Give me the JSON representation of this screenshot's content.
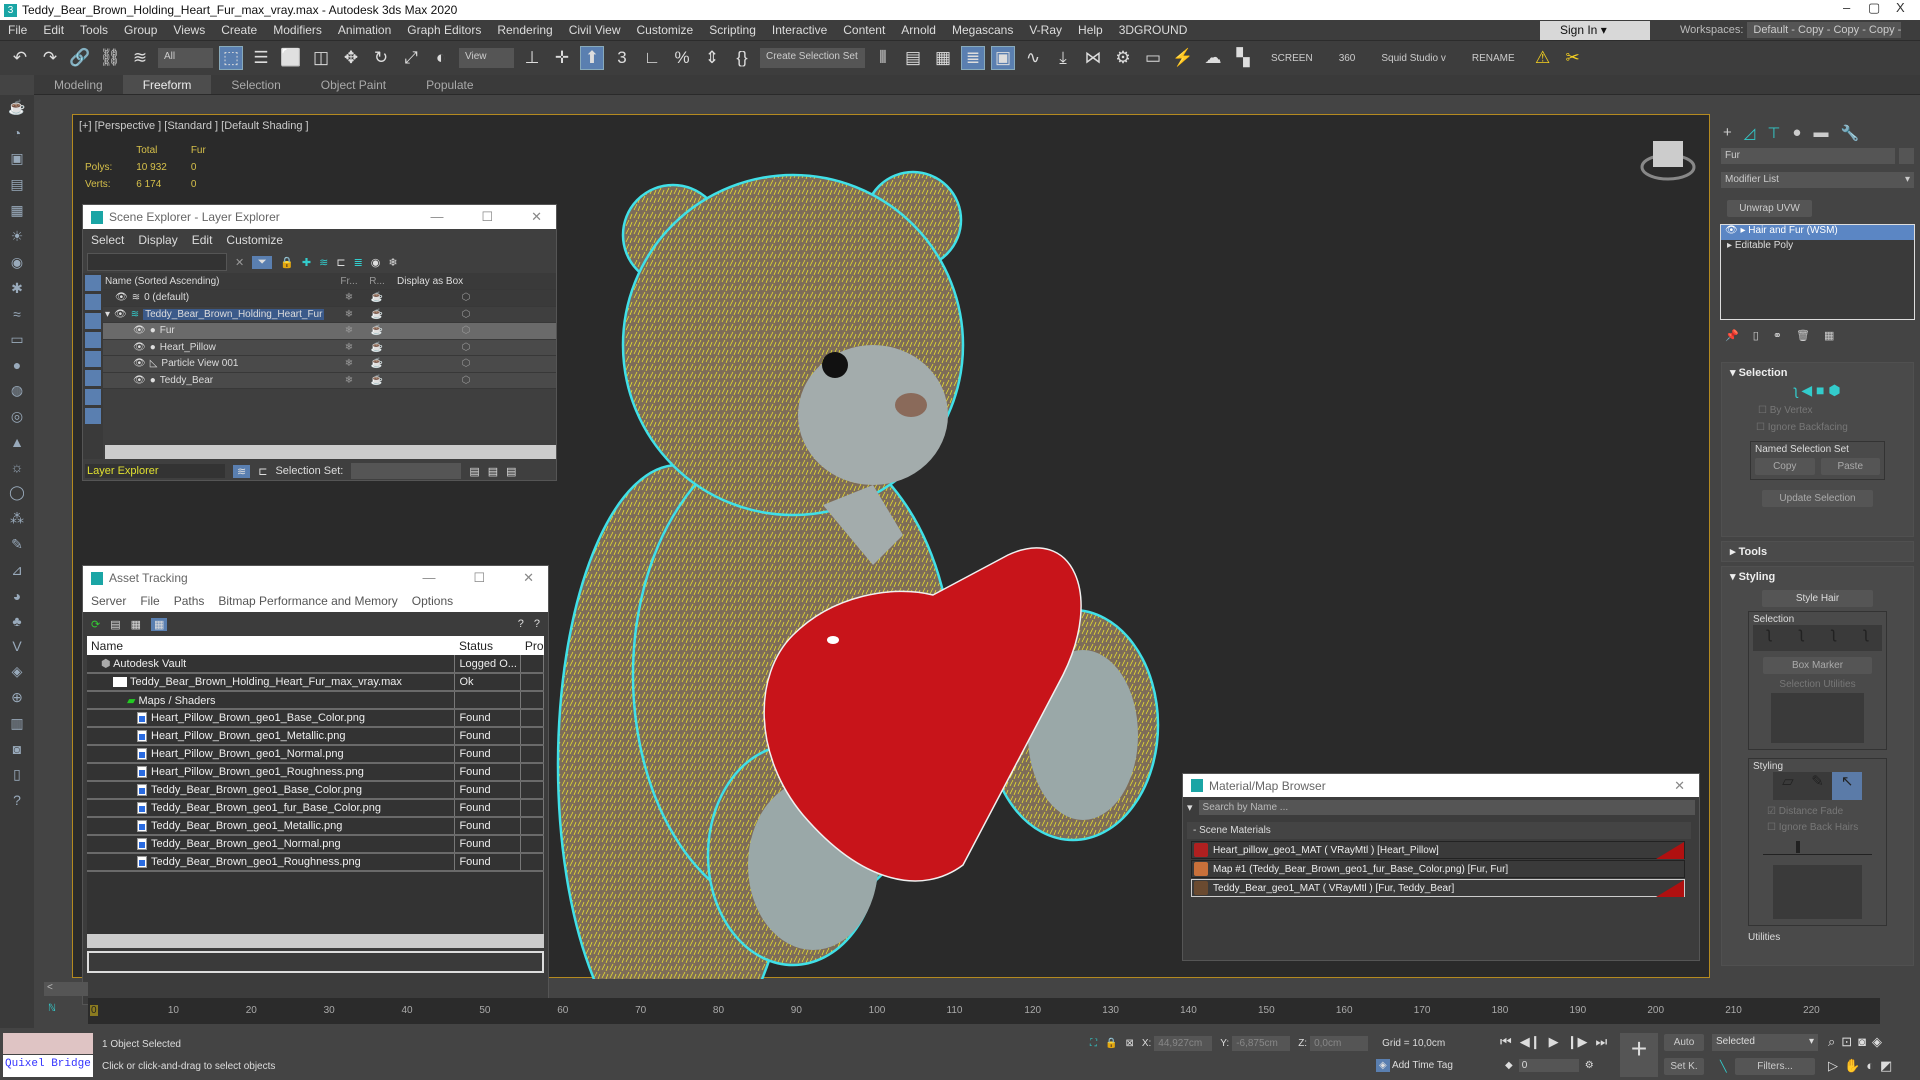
{
  "titlebar": {
    "title": "Teddy_Bear_Brown_Holding_Heart_Fur_max_vray.max - Autodesk 3ds Max 2020",
    "minimize": "–",
    "maximize": "▢",
    "close": "X"
  },
  "menu": [
    "File",
    "Edit",
    "Tools",
    "Group",
    "Views",
    "Create",
    "Modifiers",
    "Animation",
    "Graph Editors",
    "Rendering",
    "Civil View",
    "Customize",
    "Scripting",
    "Interactive",
    "Content",
    "Arnold",
    "Megascans",
    "V-Ray",
    "Help",
    "3DGROUND"
  ],
  "account": {
    "sign_in": "Sign In",
    "workspaces_label": "Workspaces:",
    "workspace": "Default - Copy - Copy - Copy - Copy"
  },
  "toolbar": {
    "filter": "All",
    "ref_coord": "View",
    "selection_set": "Create Selection Set",
    "screen": "SCREEN",
    "n360": "360",
    "studio": "Squid Studio v",
    "rename": "RENAME"
  },
  "ribbon": {
    "tabs": [
      "Modeling",
      "Freeform",
      "Selection",
      "Object Paint",
      "Populate"
    ],
    "active": "Freeform"
  },
  "viewport": {
    "label": "[+] [Perspective ] [Standard ] [Default Shading ]",
    "stats": {
      "col_total": "Total",
      "col_fur": "Fur",
      "polys_label": "Polys:",
      "polys_total": "10 932",
      "polys_fur": "0",
      "verts_label": "Verts:",
      "verts_total": "6 174",
      "verts_fur": "0"
    }
  },
  "scene_explorer": {
    "title": "Scene Explorer - Layer Explorer",
    "menu": [
      "Select",
      "Display",
      "Edit",
      "Customize"
    ],
    "columns": {
      "name": "Name (Sorted Ascending)",
      "freeze": "Fr...",
      "render": "R...",
      "box": "Display as Box"
    },
    "rows": [
      {
        "name": "0 (default)",
        "level": 0
      },
      {
        "name": "Teddy_Bear_Brown_Holding_Heart_Fur",
        "level": 0
      },
      {
        "name": "Fur",
        "level": 1
      },
      {
        "name": "Heart_Pillow",
        "level": 1
      },
      {
        "name": "Particle View 001",
        "level": 1
      },
      {
        "name": "Teddy_Bear",
        "level": 1
      }
    ],
    "footer": {
      "mode": "Layer Explorer",
      "selection_set_label": "Selection Set:"
    }
  },
  "asset_tracking": {
    "title": "Asset Tracking",
    "menu": [
      "Server",
      "File",
      "Paths",
      "Bitmap Performance and Memory",
      "Options"
    ],
    "columns": [
      "Name",
      "Status",
      "Pro"
    ],
    "rows": [
      {
        "name": "Autodesk Vault",
        "status": "Logged O..."
      },
      {
        "name": "Teddy_Bear_Brown_Holding_Heart_Fur_max_vray.max",
        "status": "Ok"
      },
      {
        "name": "Maps / Shaders",
        "status": ""
      },
      {
        "name": "Heart_Pillow_Brown_geo1_Base_Color.png",
        "status": "Found"
      },
      {
        "name": "Heart_Pillow_Brown_geo1_Metallic.png",
        "status": "Found"
      },
      {
        "name": "Heart_Pillow_Brown_geo1_Normal.png",
        "status": "Found"
      },
      {
        "name": "Heart_Pillow_Brown_geo1_Roughness.png",
        "status": "Found"
      },
      {
        "name": "Teddy_Bear_Brown_geo1_Base_Color.png",
        "status": "Found"
      },
      {
        "name": "Teddy_Bear_Brown_geo1_fur_Base_Color.png",
        "status": "Found"
      },
      {
        "name": "Teddy_Bear_Brown_geo1_Metallic.png",
        "status": "Found"
      },
      {
        "name": "Teddy_Bear_Brown_geo1_Normal.png",
        "status": "Found"
      },
      {
        "name": "Teddy_Bear_Brown_geo1_Roughness.png",
        "status": "Found"
      }
    ]
  },
  "material_browser": {
    "title": "Material/Map Browser",
    "search_placeholder": "Search by Name ...",
    "group": "- Scene Materials",
    "items": [
      {
        "label": "Heart_pillow_geo1_MAT  ( VRayMtl )  [Heart_Pillow]",
        "swatch": "#b02020"
      },
      {
        "label": "Map #1 (Teddy_Bear_Brown_geo1_fur_Base_Color.png)  [Fur, Fur]",
        "swatch": "#c8703a"
      },
      {
        "label": "Teddy_Bear_geo1_MAT  ( VRayMtl )  [Fur, Teddy_Bear]",
        "swatch": "#6a4a30"
      }
    ]
  },
  "command_panel": {
    "object_name": "Fur",
    "modifier_list": "Modifier List",
    "unwrap": "Unwrap UVW",
    "stack": [
      "Hair and Fur (WSM)",
      "Editable Poly"
    ],
    "selection": {
      "title": "Selection",
      "by_vertex": "By Vertex",
      "ignore_backfacing": "Ignore Backfacing",
      "named_set": "Named Selection Set",
      "copy": "Copy",
      "paste": "Paste",
      "update": "Update Selection"
    },
    "tools": "Tools",
    "styling": {
      "title": "Styling",
      "style_hair": "Style Hair",
      "selection": "Selection",
      "box_marker": "Box Marker",
      "sel_utils": "Selection Utilities",
      "styling": "Styling",
      "distance_fade": "Distance Fade",
      "ignore_back": "Ignore Back Hairs",
      "utilities": "Utilities",
      "slider_value": 0.3
    }
  },
  "timeline": {
    "ticks": [
      "0",
      "10",
      "20",
      "30",
      "40",
      "50",
      "60",
      "70",
      "80",
      "90",
      "100",
      "110",
      "120",
      "130",
      "140",
      "150",
      "160",
      "170",
      "180",
      "190",
      "200",
      "210",
      "220"
    ]
  },
  "status": {
    "selected": "1 Object Selected",
    "hint": "Click or click-and-drag to select objects",
    "quixel": "Quixel Bridge",
    "x_label": "X:",
    "x": "44,927cm",
    "y_label": "Y:",
    "y": "-6,875cm",
    "z_label": "Z:",
    "z": "0,0cm",
    "grid": "Grid = 10,0cm",
    "add_time_tag": "Add Time Tag",
    "frame": "0",
    "auto": "Auto",
    "set_key": "Set K.",
    "key_filter": "Selected",
    "filters": "Filters..."
  }
}
